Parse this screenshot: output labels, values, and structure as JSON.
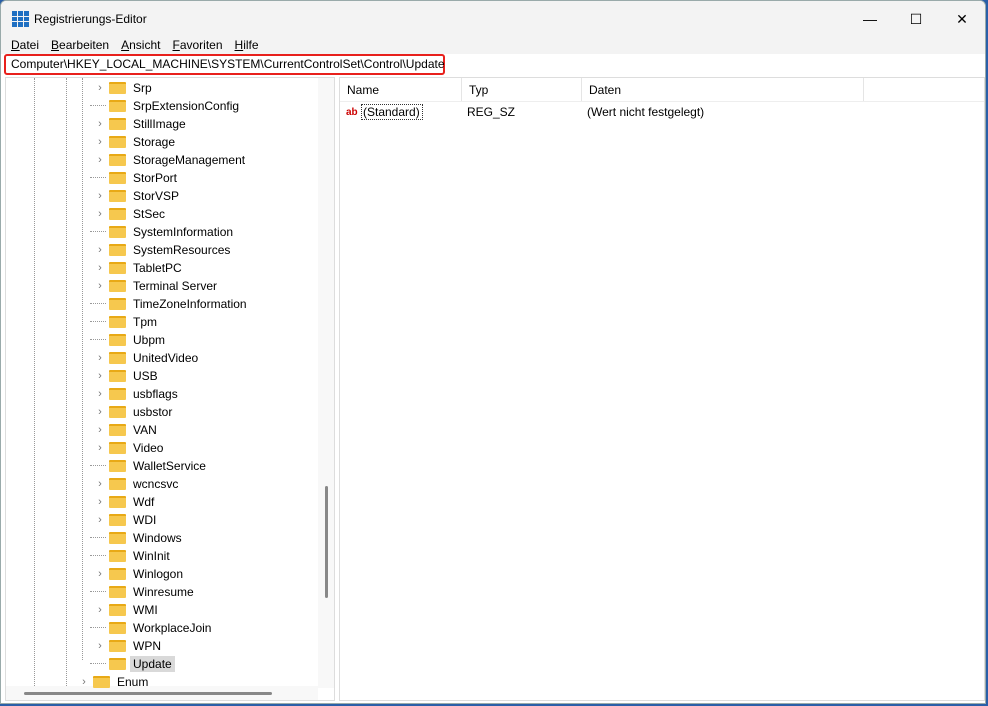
{
  "window": {
    "title": "Registrierungs-Editor",
    "minimize": "—",
    "maximize": "☐",
    "close": "✕"
  },
  "menu": [
    {
      "u": "D",
      "rest": "atei"
    },
    {
      "u": "B",
      "rest": "earbeiten"
    },
    {
      "u": "A",
      "rest": "nsicht"
    },
    {
      "u": "F",
      "rest": "avoriten"
    },
    {
      "u": "H",
      "rest": "ilfe"
    }
  ],
  "address": "Computer\\HKEY_LOCAL_MACHINE\\SYSTEM\\CurrentControlSet\\Control\\Update",
  "tree": {
    "items": [
      {
        "label": "Srp",
        "expandable": true
      },
      {
        "label": "SrpExtensionConfig",
        "expandable": false
      },
      {
        "label": "StillImage",
        "expandable": true
      },
      {
        "label": "Storage",
        "expandable": true
      },
      {
        "label": "StorageManagement",
        "expandable": true
      },
      {
        "label": "StorPort",
        "expandable": false
      },
      {
        "label": "StorVSP",
        "expandable": true
      },
      {
        "label": "StSec",
        "expandable": true
      },
      {
        "label": "SystemInformation",
        "expandable": false
      },
      {
        "label": "SystemResources",
        "expandable": true
      },
      {
        "label": "TabletPC",
        "expandable": true
      },
      {
        "label": "Terminal Server",
        "expandable": true
      },
      {
        "label": "TimeZoneInformation",
        "expandable": false
      },
      {
        "label": "Tpm",
        "expandable": false
      },
      {
        "label": "Ubpm",
        "expandable": false
      },
      {
        "label": "UnitedVideo",
        "expandable": true
      },
      {
        "label": "USB",
        "expandable": true
      },
      {
        "label": "usbflags",
        "expandable": true
      },
      {
        "label": "usbstor",
        "expandable": true
      },
      {
        "label": "VAN",
        "expandable": true
      },
      {
        "label": "Video",
        "expandable": true
      },
      {
        "label": "WalletService",
        "expandable": false
      },
      {
        "label": "wcncsvc",
        "expandable": true
      },
      {
        "label": "Wdf",
        "expandable": true
      },
      {
        "label": "WDI",
        "expandable": true
      },
      {
        "label": "Windows",
        "expandable": false
      },
      {
        "label": "WinInit",
        "expandable": false
      },
      {
        "label": "Winlogon",
        "expandable": true
      },
      {
        "label": "Winresume",
        "expandable": false
      },
      {
        "label": "WMI",
        "expandable": true
      },
      {
        "label": "WorkplaceJoin",
        "expandable": false
      },
      {
        "label": "WPN",
        "expandable": true
      },
      {
        "label": "Update",
        "expandable": false,
        "selected": true
      }
    ],
    "parent_sibling": {
      "label": "Enum",
      "expandable": true
    }
  },
  "values": {
    "columns": [
      "Name",
      "Typ",
      "Daten"
    ],
    "rows": [
      {
        "name": "(Standard)",
        "type": "REG_SZ",
        "data": "(Wert nicht festgelegt)",
        "icon": "string-value-icon"
      }
    ]
  }
}
